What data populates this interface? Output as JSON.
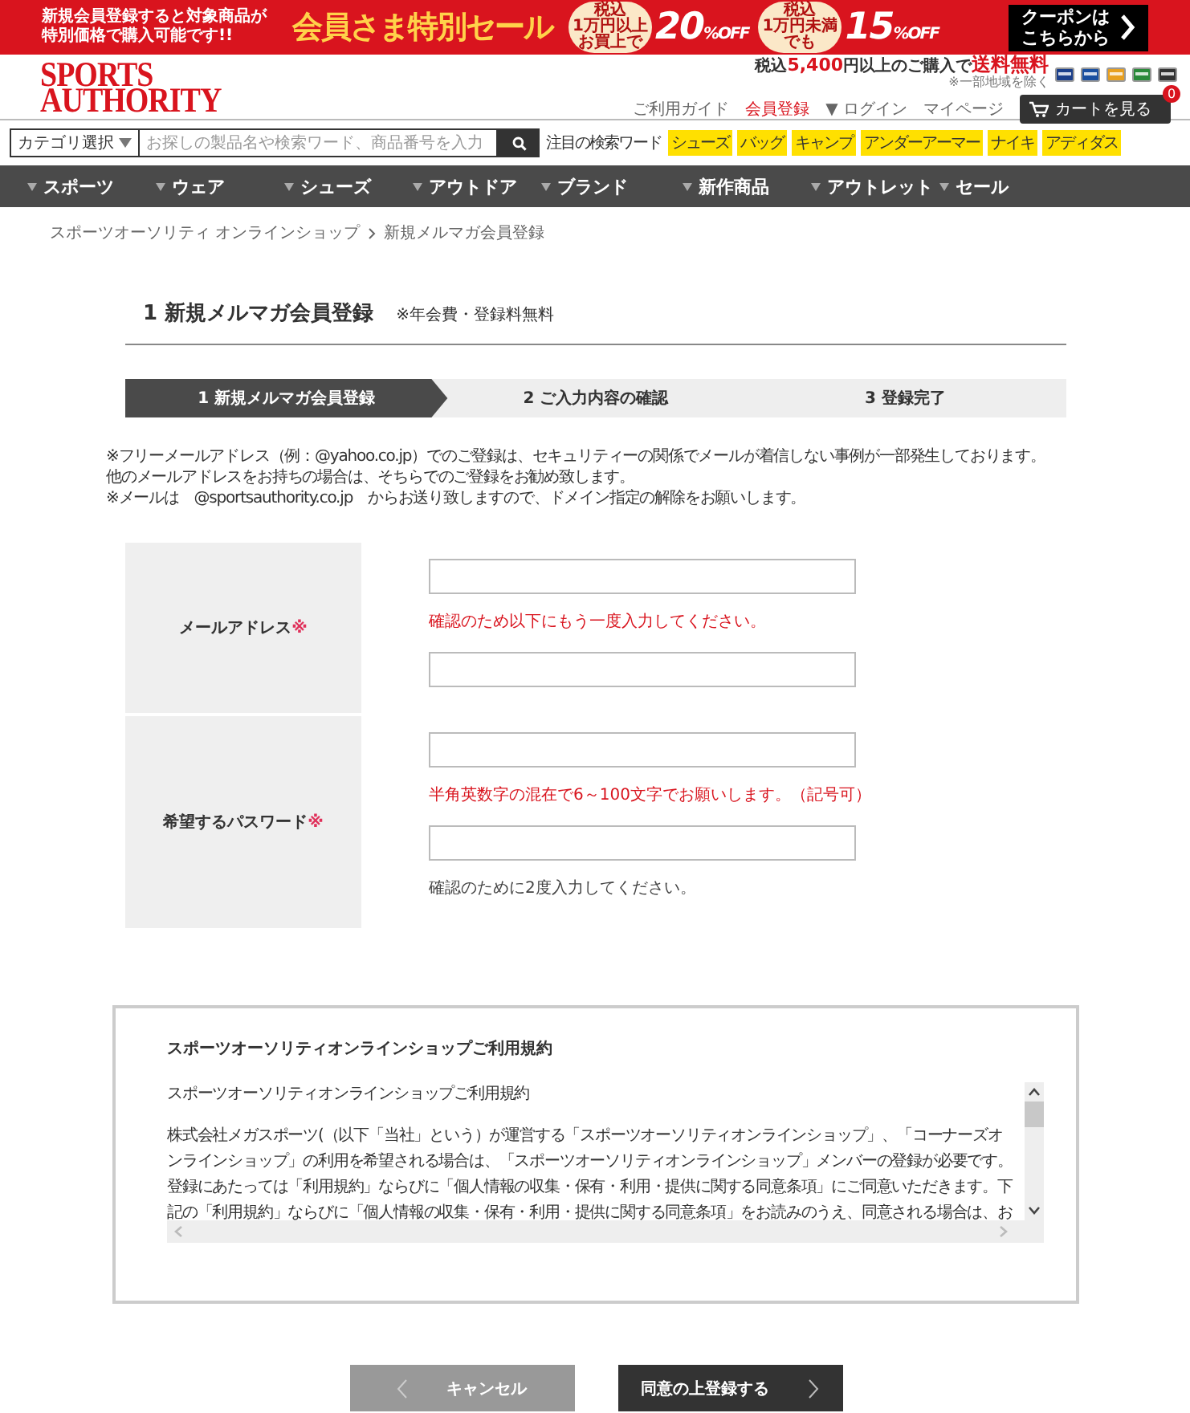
{
  "banner": {
    "lead_lines": [
      "新規会員登録すると対象商品が",
      "特別価格で購入可能です!!"
    ],
    "headline": "会員さま特別セール",
    "offers": [
      {
        "condition": [
          "税込",
          "1万円以上",
          "お買上で"
        ],
        "value": "20",
        "unit": "%OFF"
      },
      {
        "condition": [
          "税込",
          "1万円未満",
          "でも"
        ],
        "value": "15",
        "unit": "%OFF"
      }
    ],
    "coupon": [
      "クーポンは",
      "こちらから"
    ]
  },
  "header": {
    "logo": [
      "SPORTS",
      "AUTHORITY"
    ],
    "shipping": {
      "prefix": "税込",
      "amount": "5,400",
      "middle": "円以上のご購入で",
      "free": "送料無料"
    },
    "shipping_note": "※一部地域を除く",
    "links": [
      {
        "label": "ご利用ガイド",
        "active": false
      },
      {
        "label": "会員登録",
        "active": true
      },
      {
        "label": "▼ ログイン",
        "active": false
      },
      {
        "label": "マイページ",
        "active": false
      }
    ],
    "cart": {
      "label": "カートを見る",
      "count": "0"
    }
  },
  "search": {
    "category": "カテゴリ選択",
    "placeholder": "お探しの製品名や検索ワード、商品番号を入力",
    "trending_label": "注目の検索ワード",
    "tags": [
      "シューズ",
      "バッグ",
      "キャンプ",
      "アンダーアーマー",
      "ナイキ",
      "アディダス"
    ]
  },
  "nav": [
    "スポーツ",
    "ウェア",
    "シューズ",
    "アウトドア",
    "ブランド",
    "新作商品",
    "アウトレット",
    "セール"
  ],
  "breadcrumb": [
    "スポーツオーソリティ オンラインショップ",
    "新規メルマガ会員登録"
  ],
  "page": {
    "title": "1 新規メルマガ会員登録",
    "subtitle": "※年会費・登録料無料"
  },
  "steps": [
    {
      "label": "1 新規メルマガ会員登録",
      "selected": true
    },
    {
      "label": "2 ご入力内容の確認",
      "selected": false
    },
    {
      "label": "3 登録完了",
      "selected": false
    }
  ],
  "notes": [
    "※フリーメールアドレス（例：@yahoo.co.jp）でのご登録は、セキュリティーの関係でメールが着信しない事例が一部発生しております。",
    "他のメールアドレスをお持ちの場合は、そちらでのご登録をお勧め致します。",
    "※メールは　@sportsauthority.co.jp　からお送り致しますので、ドメイン指定の解除をお願いします。"
  ],
  "form": [
    {
      "label": "メールアドレス",
      "mark": "※",
      "fields": [
        {
          "kind": "input"
        },
        {
          "kind": "hint",
          "text": "確認のため以下にもう一度入力してください。",
          "alert": true
        },
        {
          "kind": "input"
        }
      ]
    },
    {
      "label": "希望するパスワード",
      "mark": "※",
      "fields": [
        {
          "kind": "input"
        },
        {
          "kind": "hint",
          "text": "半角英数字の混在で6～100文字でお願いします。（記号可）",
          "alert": true
        },
        {
          "kind": "input"
        },
        {
          "kind": "hint",
          "text": "確認のために2度入力してください。",
          "alert": false
        }
      ]
    }
  ],
  "terms": {
    "title": "スポーツオーソリティオンラインショップご利用規約",
    "lines": [
      "スポーツオーソリティオンラインショップご利用規約",
      "株式会社メガスポーツ(（以下「当社」という）が運営する「スポーツオーソリティオンラインショップ」、「コーナーズオ",
      "ンラインショップ」の利用を希望される場合は、「スポーツオーソリティオンラインショップ」メンバーの登録が必要です。",
      "登録にあたっては「利用規約」ならびに「個人情報の収集・保有・利用・提供に関する同意条項」にご同意いただきます。下",
      "記の「利用規約」ならびに「個人情報の収集・保有・利用・提供に関する同意条項」をお読みのうえ、同意される場合は、お"
    ]
  },
  "buttons": {
    "cancel": "キャンセル",
    "submit": "同意の上登録する"
  }
}
